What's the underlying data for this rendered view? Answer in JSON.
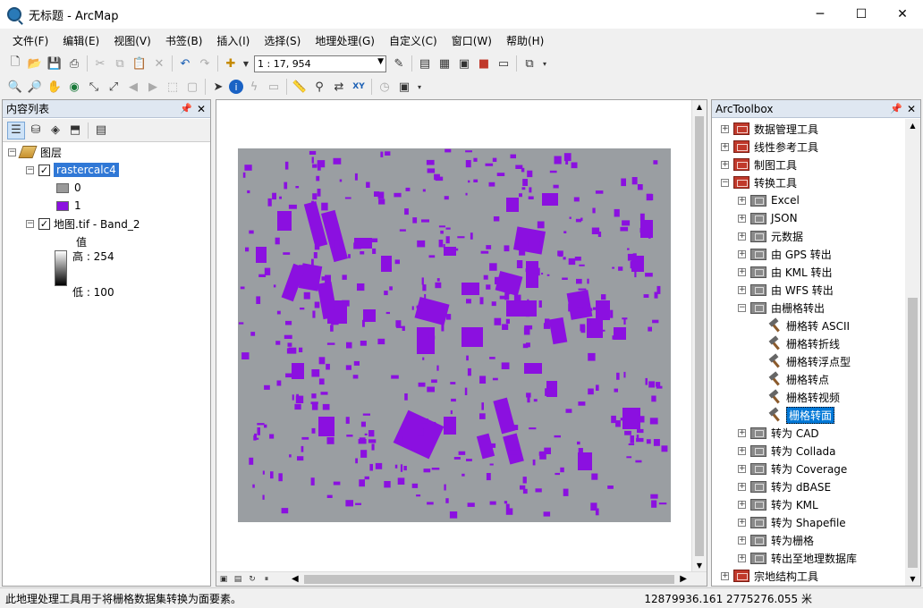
{
  "window": {
    "title": "无标题 - ArcMap",
    "minimize": "─",
    "maximize": "☐",
    "close": "✕"
  },
  "menu": [
    "文件(F)",
    "编辑(E)",
    "视图(V)",
    "书签(B)",
    "插入(I)",
    "选择(S)",
    "地理处理(G)",
    "自定义(C)",
    "窗口(W)",
    "帮助(H)"
  ],
  "toolbar": {
    "scale": "1 : 17, 954"
  },
  "toc": {
    "title": "内容列表",
    "root": "图层",
    "layers": [
      {
        "name": "rastercalc4",
        "classes": [
          {
            "label": "0",
            "color": "#9a9a9a"
          },
          {
            "label": "1",
            "color": "#8b10e0"
          }
        ]
      },
      {
        "name": "地图.tif - Band_2",
        "value_label": "值",
        "high": "高 : 254",
        "low": "低 : 100"
      }
    ]
  },
  "map": {
    "background": "#9a9ea2",
    "feature_color": "#8b10e0"
  },
  "toolbox": {
    "title": "ArcToolbox",
    "items": [
      {
        "label": "数据管理工具",
        "level": 0,
        "exp": "+",
        "icon": "toolbox"
      },
      {
        "label": "线性参考工具",
        "level": 0,
        "exp": "+",
        "icon": "toolbox"
      },
      {
        "label": "制图工具",
        "level": 0,
        "exp": "+",
        "icon": "toolbox"
      },
      {
        "label": "转换工具",
        "level": 0,
        "exp": "−",
        "icon": "toolbox"
      },
      {
        "label": "Excel",
        "level": 1,
        "exp": "+",
        "icon": "toolset"
      },
      {
        "label": "JSON",
        "level": 1,
        "exp": "+",
        "icon": "toolset"
      },
      {
        "label": "元数据",
        "level": 1,
        "exp": "+",
        "icon": "toolset"
      },
      {
        "label": "由 GPS 转出",
        "level": 1,
        "exp": "+",
        "icon": "toolset"
      },
      {
        "label": "由 KML 转出",
        "level": 1,
        "exp": "+",
        "icon": "toolset"
      },
      {
        "label": "由 WFS 转出",
        "level": 1,
        "exp": "+",
        "icon": "toolset"
      },
      {
        "label": "由栅格转出",
        "level": 1,
        "exp": "−",
        "icon": "toolset"
      },
      {
        "label": "栅格转 ASCII",
        "level": 2,
        "exp": "",
        "icon": "tool"
      },
      {
        "label": "栅格转折线",
        "level": 2,
        "exp": "",
        "icon": "tool"
      },
      {
        "label": "栅格转浮点型",
        "level": 2,
        "exp": "",
        "icon": "tool"
      },
      {
        "label": "栅格转点",
        "level": 2,
        "exp": "",
        "icon": "tool"
      },
      {
        "label": "栅格转视频",
        "level": 2,
        "exp": "",
        "icon": "tool"
      },
      {
        "label": "栅格转面",
        "level": 2,
        "exp": "",
        "icon": "tool",
        "selected": true
      },
      {
        "label": "转为 CAD",
        "level": 1,
        "exp": "+",
        "icon": "toolset"
      },
      {
        "label": "转为 Collada",
        "level": 1,
        "exp": "+",
        "icon": "toolset"
      },
      {
        "label": "转为 Coverage",
        "level": 1,
        "exp": "+",
        "icon": "toolset"
      },
      {
        "label": "转为 dBASE",
        "level": 1,
        "exp": "+",
        "icon": "toolset"
      },
      {
        "label": "转为 KML",
        "level": 1,
        "exp": "+",
        "icon": "toolset"
      },
      {
        "label": "转为 Shapefile",
        "level": 1,
        "exp": "+",
        "icon": "toolset"
      },
      {
        "label": "转为栅格",
        "level": 1,
        "exp": "+",
        "icon": "toolset"
      },
      {
        "label": "转出至地理数据库",
        "level": 1,
        "exp": "+",
        "icon": "toolset"
      },
      {
        "label": "宗地结构工具",
        "level": 0,
        "exp": "+",
        "icon": "toolbox"
      }
    ]
  },
  "status": {
    "message": "此地理处理工具用于将栅格数据集转换为面要素。",
    "coords": "12879936.161  2775276.055 米"
  }
}
